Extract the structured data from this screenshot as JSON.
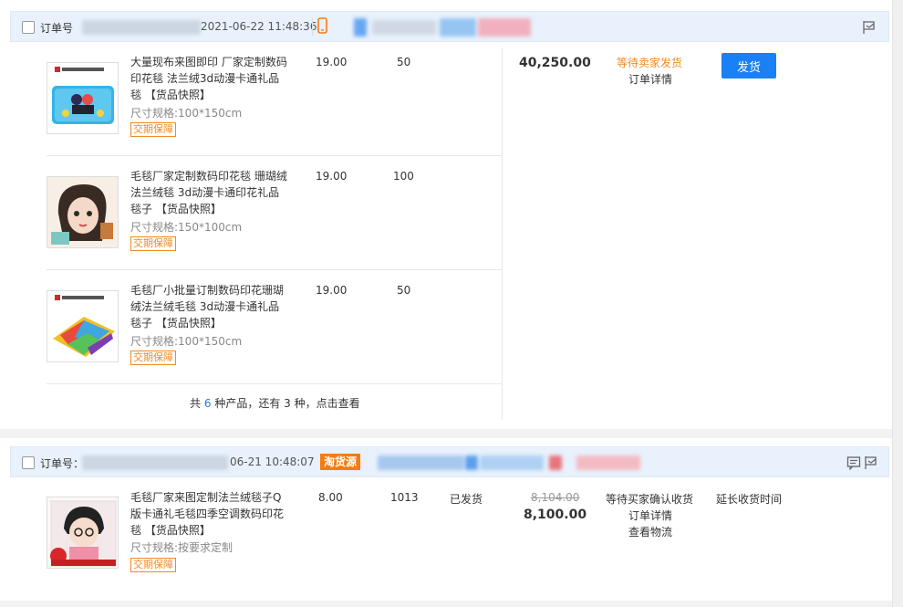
{
  "orders": [
    {
      "order_label": "订单号",
      "time": "2021-06-22 11:48:36",
      "items": [
        {
          "title": "大量现布来图即印 厂家定制数码印花毯 法兰绒3d动漫卡通礼品毯 【货品快照】",
          "spec": "尺寸规格:100*150cm",
          "guarantee": "交期保障",
          "price": "19.00",
          "qty": "50"
        },
        {
          "title": "毛毯厂家定制数码印花毯 珊瑚绒法兰绒毯 3d动漫卡通印花礼品毯子 【货品快照】",
          "spec": "尺寸规格:150*100cm",
          "guarantee": "交期保障",
          "price": "19.00",
          "qty": "100"
        },
        {
          "title": "毛毯厂小批量订制数码印花珊瑚绒法兰绒毛毯 3d动漫卡通礼品毯子 【货品快照】",
          "spec": "尺寸规格:100*150cm",
          "guarantee": "交期保障",
          "price": "19.00",
          "qty": "50"
        }
      ],
      "total": "40,250.00",
      "status": "等待卖家发货",
      "detail_link": "订单详情",
      "ship_button": "发货",
      "more": {
        "prefix": "共",
        "count": "6",
        "middle": "种产品，还有",
        "remaining": "3",
        "suffix": "种，点击查看"
      }
    },
    {
      "order_label": "订单号：",
      "time": "06-21 10:48:07",
      "source_badge": "淘货源",
      "items": [
        {
          "title": "毛毯厂家来图定制法兰绒毯子Q版卡通礼毛毯四季空调数码印花毯 【货品快照】",
          "spec": "尺寸规格:按要求定制",
          "guarantee": "交期保障",
          "price": "8.00",
          "qty": "1013",
          "ship_status": "已发货"
        }
      ],
      "original_total": "8,104.00",
      "total": "8,100.00",
      "status": "等待买家确认收货",
      "detail_link": "订单详情",
      "logistics_link": "查看物流",
      "extend_link": "延长收货时间"
    }
  ]
}
